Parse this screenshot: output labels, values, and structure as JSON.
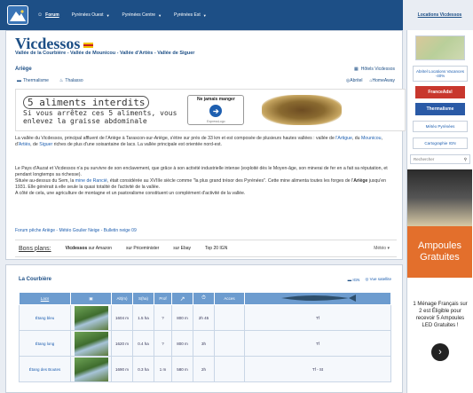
{
  "nav": {
    "forum": "Forum",
    "ouest": "Pyrénées Ouest",
    "centre": "Pyrénées Centre",
    "est": "Pyrénées Est"
  },
  "locations": "Locations Vicdessos",
  "page": {
    "title": "Vicdessos",
    "subtitle": "Vallée de la Courbière - Vallée de Mounicou - Vallée d'Artiès - Vallée de Siguer",
    "region": "Ariège",
    "hotels": "Hôtels Vicdessos",
    "thermalisme": "Thermalisme",
    "thalasso": "Thalasso",
    "abritel": "Abritel",
    "homeaway": "HomeAway"
  },
  "ad": {
    "line1": "5 aliments interdits",
    "line2": "Si vous arrêtez ces 5 aliments, vous",
    "line3": "enlevez la graisse abdominale",
    "box": "Ne jamais manger",
    "btn": "➔",
    "small": "ExpressLogo"
  },
  "text": {
    "p1a": "La vallée du Vicdessos, principal affluent de l'Ariège à Tarascon-sur-Ariège, s'étire sur près de 33 km et est composée de plusieurs hautes vallées : vallée de ",
    "p1l1": "l'Artigue",
    "p1b": ", du ",
    "p1l2": "Mounicou",
    "p1c": ", d'",
    "p1l3": "Artiès",
    "p1d": ", de ",
    "p1l4": "Siguer",
    "p1e": " riches de plus d'une soixantaine de lacs. La vallée principale est orientée nord-est.",
    "p2a": "Le Pays d'Auzat et Vicdessos n'a pu survivre de son enclavement, que grâce à son activité industrielle intense (exploité dès le Moyen-âge, son minerai de fer en a fait sa réputation, et pendant longtemps sa richesse).",
    "p2b": "Située au-dessus du Sem, la ",
    "p2l": "mine de Rancié",
    "p2c": ", était considérée au XVIIIe siècle comme \"la plus grand trésor des Pyrénées\". Cette mine alimenta toutes les forges de l'",
    "p2bold": "Ariège",
    "p2d": " jusqu'en 1931. Elle générait à elle seule la quasi totalité de l'activité de la vallée.",
    "p2e": "A côté de cela, une agriculture de montagne et un pastoralisme constituent un complément d'activité de la vallée."
  },
  "forum_links": "Forum pêche Ariège - Météo Goulier Neige - Bulletin neige 09",
  "bons_plans": {
    "label": "Bons plans:",
    "item1b": "Vicdessos",
    "item1": " sur Amazon",
    "item2": "sur Priceminister",
    "item3": "sur Ebay",
    "item4": "Top 20 IGN",
    "more": "Météo"
  },
  "courbiere": {
    "title": "La Courbière",
    "ign": "IGN",
    "satellite": "Vue satellite",
    "headers": [
      "Lacs",
      "",
      "Alt(m)",
      "S(ha)",
      "Prof",
      "↗",
      "⏱",
      "Acces",
      ""
    ],
    "rows": [
      {
        "name": "Étang bleu",
        "alt": "1604 m",
        "surf": "1.5 ha",
        "prof": "?",
        "d1": "800 m",
        "d2": "2h 45",
        "fish": "Tf"
      },
      {
        "name": "Étang long",
        "alt": "1620 m",
        "surf": "0.4 ha",
        "prof": "?",
        "d1": "800 m",
        "d2": "3h",
        "fish": "Tf"
      },
      {
        "name": "Étang des Boutes",
        "alt": "1690 m",
        "surf": "0.3 ha",
        "prof": "1 m",
        "d1": "580 m",
        "d2": "2h",
        "fish": "Tf - St"
      }
    ]
  },
  "sidebar": {
    "abritel": "Abritel Locations Vacances -40%",
    "france_adsl": "FranceAdsl",
    "thermalisme": "Thermalisme",
    "meteo": "Météo Pyrénées",
    "carto": "Cartographie IGN",
    "search": "Rechercher",
    "amp": "Ampoules Gratuites",
    "offer": "1 Ménage Français sur 2 est Éligible pour recevoir 5 Ampoules LED Gratuites !"
  }
}
